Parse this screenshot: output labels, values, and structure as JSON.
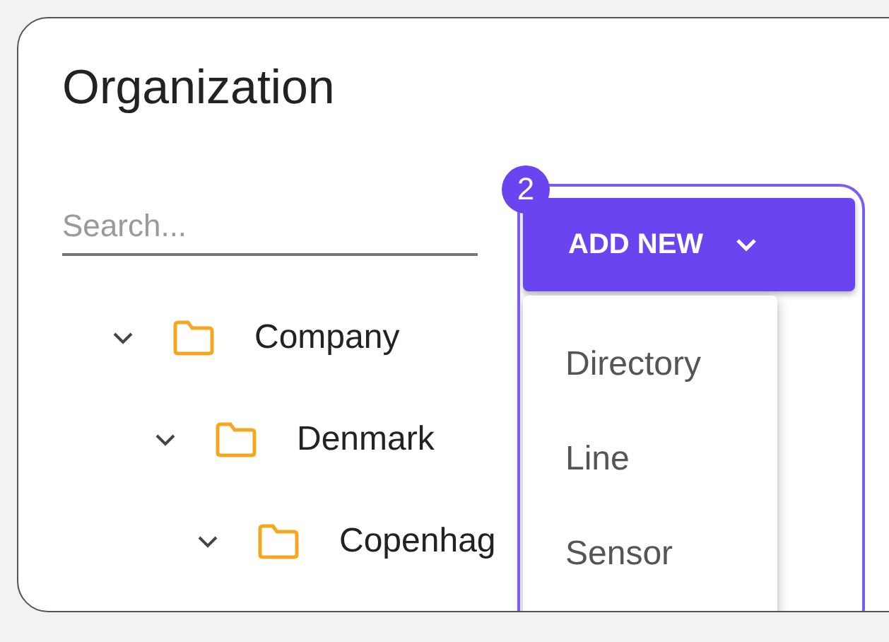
{
  "title": "Organization",
  "search": {
    "placeholder": "Search..."
  },
  "add_button": {
    "label": "ADD NEW",
    "expanded": true
  },
  "menu": {
    "items": [
      {
        "label": "Directory"
      },
      {
        "label": "Line"
      },
      {
        "label": "Sensor"
      }
    ]
  },
  "tree": [
    {
      "label": "Company",
      "expanded": true,
      "children": [
        {
          "label": "Denmark",
          "expanded": true,
          "children": [
            {
              "label": "Copenhag",
              "expanded": true
            }
          ]
        }
      ]
    }
  ],
  "callout": {
    "number": "2"
  }
}
